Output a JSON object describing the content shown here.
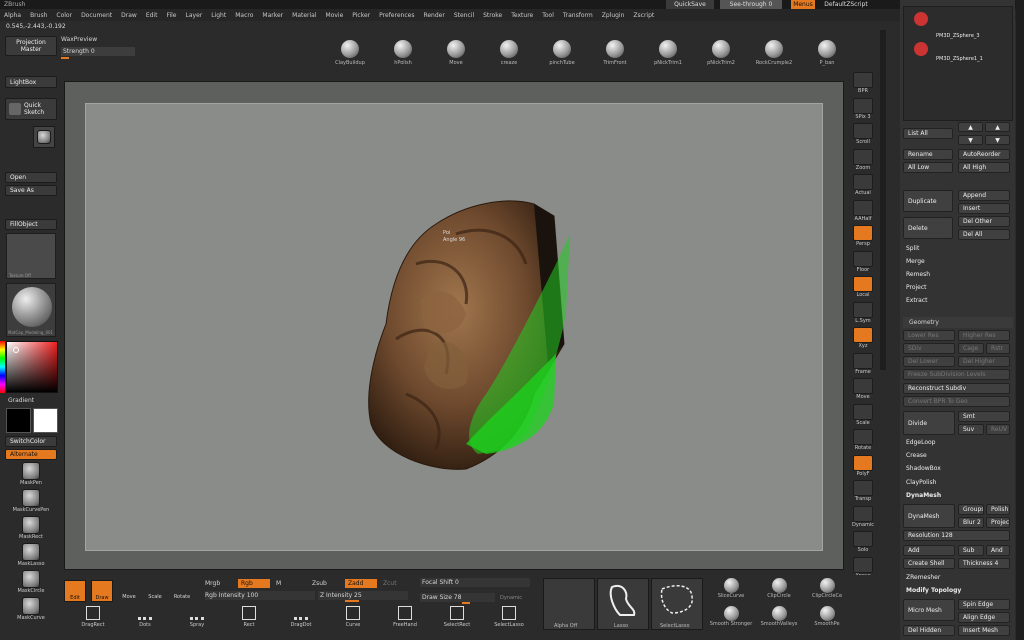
{
  "app": {
    "title": "ZBrush"
  },
  "titlebar": {
    "quicksave": "QuickSave",
    "see_through": "See-through 0",
    "menus": "Menus",
    "default_script": "DefaultZScript"
  },
  "menubar": [
    "Alpha",
    "Brush",
    "Color",
    "Document",
    "Draw",
    "Edit",
    "File",
    "Layer",
    "Light",
    "Macro",
    "Marker",
    "Material",
    "Movie",
    "Picker",
    "Preferences",
    "Render",
    "Stencil",
    "Stroke",
    "Texture",
    "Tool",
    "Transform",
    "Zplugin",
    "Zscript"
  ],
  "coords": "0.545,-2.443,-0.192",
  "top_left": {
    "projection_master": "Projection Master",
    "wax_preview": "WaxPreview",
    "strength": "Strength 0"
  },
  "brushes": [
    "ClayBuildup",
    "hPolish",
    "Move",
    "creaze",
    "pinchTube",
    "TrimFront",
    "pNickTrim1",
    "pNickTrim2",
    "RockCrumple2",
    "P_ban"
  ],
  "left_shelf": {
    "lightbox": "LightBox",
    "quick_sketch": "Quick Sketch",
    "open": "Open",
    "save_as": "Save As",
    "fill_object": "FillObject",
    "texture_off": "Texture Off",
    "material": "MatCap_Modeling_001",
    "gradient": "Gradient",
    "switch_color": "SwitchColor",
    "alternate": "Alternate",
    "brush_tools": [
      "MaskPen",
      "MaskCurvePen",
      "MaskRect",
      "MaskLasso",
      "MaskCircle",
      "MaskCurve"
    ]
  },
  "viewport": {
    "overlay_line1": "Poi",
    "overlay_line2": "Angle 96"
  },
  "right_shelf": [
    "BPR",
    "SPix 3",
    "Scroll",
    "Zoom",
    "Actual",
    "AAHalf",
    "Persp",
    "Floor",
    "Local",
    "L.Sym",
    "Xyz",
    "Frame",
    "Move",
    "Scale",
    "Rotate",
    "PolyF",
    "Transp",
    "Dynamic",
    "Solo",
    "Xpose"
  ],
  "subtools": {
    "item1": "PM3D_ZSphere_3",
    "item2": "PM3D_ZSphere1_1",
    "list_all": "List All",
    "rename": "Rename",
    "auto_reorder": "AutoReorder",
    "all_low": "All Low",
    "all_high": "All High",
    "duplicate": "Duplicate",
    "append": "Append",
    "insert": "Insert",
    "delete": "Delete",
    "del_other": "Del Other",
    "del_all": "Del All",
    "split": "Split",
    "merge": "Merge",
    "remesh": "Remesh",
    "project": "Project",
    "extract": "Extract"
  },
  "geometry": {
    "title": "Geometry",
    "lower_res": "Lower Res",
    "higher_res": "Higher Res",
    "sdiv": "SDiv",
    "cage": "Cage",
    "rstr": "Rstr",
    "del_lower": "Del Lower",
    "del_higher": "Del Higher",
    "freeze": "Freeze SubDivision Levels",
    "reconstruct": "Reconstruct Subdiv",
    "convert_bpr": "Convert BPR To Geo",
    "divide": "Divide",
    "smt": "Smt",
    "suv": "Suv",
    "reuv": "ReUV",
    "edgeloop": "EdgeLoop",
    "crease": "Crease",
    "shadowbox": "ShadowBox",
    "claypolish": "ClayPolish",
    "dynamesh_header": "DynaMesh",
    "dynamesh": "DynaMesh",
    "groups": "Groups",
    "polish": "Polish",
    "blur": "Blur 2",
    "project": "Project",
    "resolution": "Resolution 128",
    "add": "Add",
    "sub": "Sub",
    "and": "And",
    "create_shell": "Create Shell",
    "thickness": "Thickness 4",
    "zremesher": "ZRemesher",
    "modify_topology": "Modify Topology",
    "micro_mesh": "Micro Mesh",
    "spin_edge": "Spin Edge",
    "align_edge": "Align Edge",
    "del_hidden": "Del Hidden",
    "insert_mesh": "Insert Mesh"
  },
  "bottom": {
    "edit": "Edit",
    "draw": "Draw",
    "move": "Move",
    "scale": "Scale",
    "rotate": "Rotate",
    "mrgb": "Mrgb",
    "rgb": "Rgb",
    "m": "M",
    "zsub": "Zsub",
    "zadd": "Zadd",
    "zcut": "Zcut",
    "rgb_intensity": "Rgb Intensity 100",
    "z_intensity": "Z Intensity 25",
    "focal_shift": "Focal Shift 0",
    "draw_size": "Draw Size 78",
    "dynamic": "Dynamic",
    "alpha_off": "Alpha Off",
    "lasso": "Lasso",
    "select_lasso": "SelectLasso",
    "stroke_row": [
      "DragRect",
      "Dots",
      "Spray",
      "Rect",
      "DragDot",
      "Curve",
      "FreeHand",
      "SelectRect",
      "SelectLasso"
    ],
    "right_brushes": [
      "SliceCurve",
      "ClipCircle",
      "ClipCircleCe",
      "Smooth Stronger",
      "SmoothValleys",
      "SmoothPe"
    ]
  },
  "colors": {
    "accent": "#e5791f",
    "viewport_bg": "#8a8c8a",
    "mesh": "#7a5538",
    "stencil": "#1cd41c"
  }
}
